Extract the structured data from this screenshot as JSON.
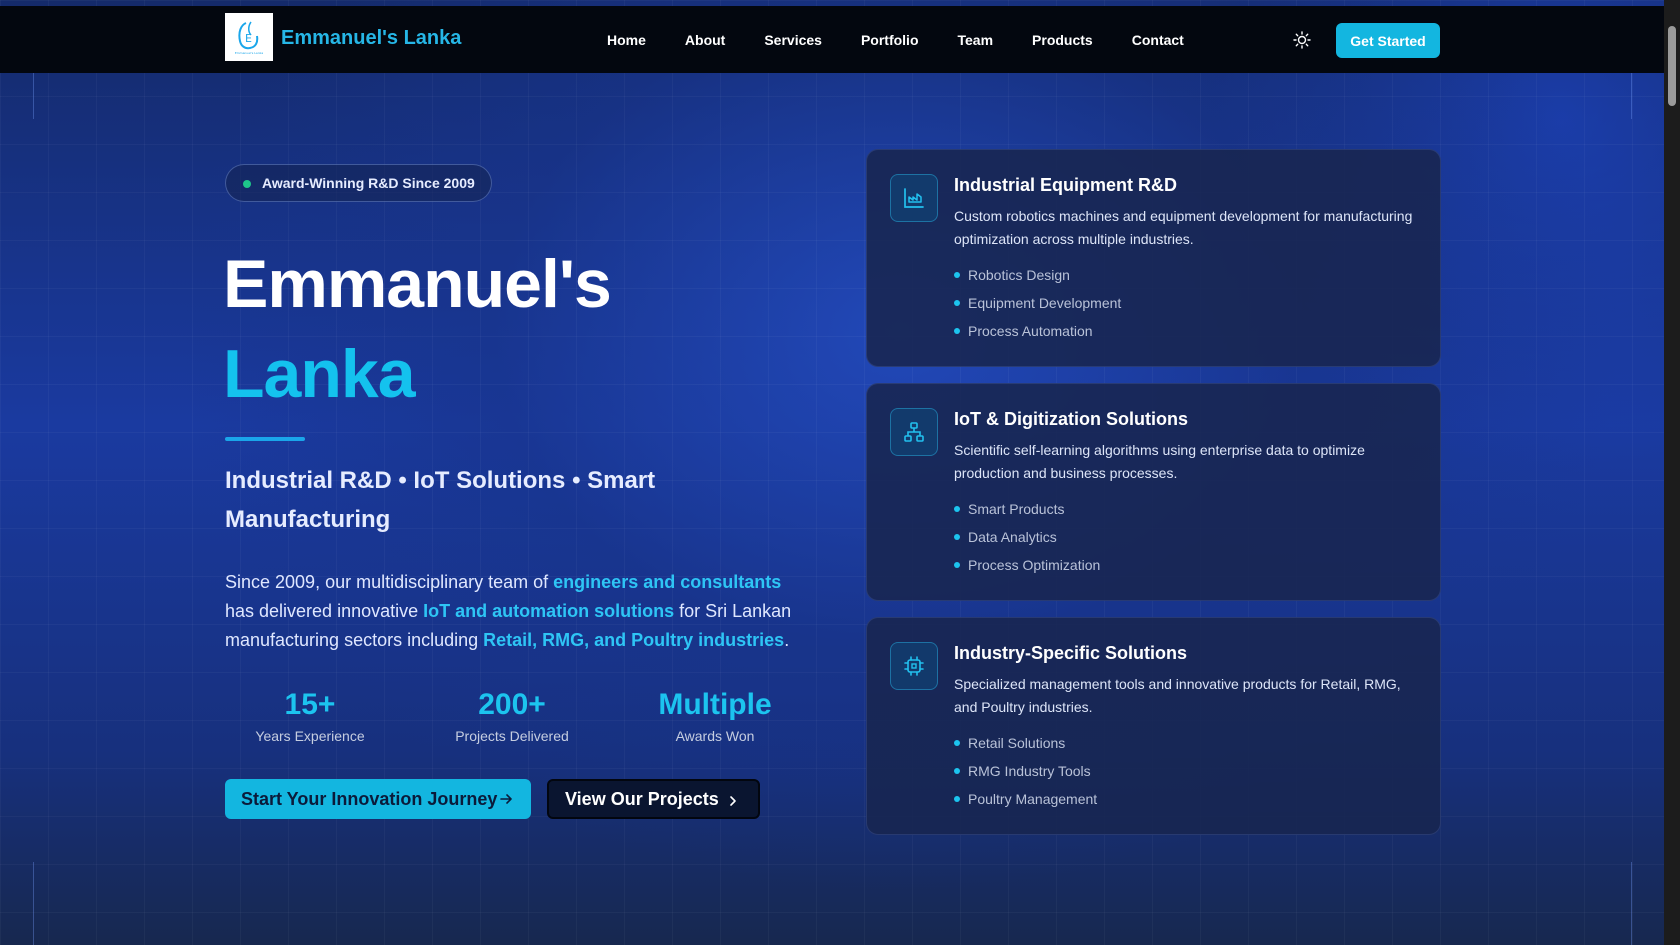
{
  "nav": {
    "brand": "Emmanuel's Lanka",
    "logo_caption": "Emmanuel's Lanka",
    "links": [
      "Home",
      "About",
      "Services",
      "Portfolio",
      "Team",
      "Products",
      "Contact"
    ],
    "cta": "Get Started"
  },
  "hero": {
    "badge": "Award-Winning R&D Since 2009",
    "title_line1": "Emmanuel's",
    "title_line2": "Lanka",
    "subtitle": "Industrial R&D • IoT Solutions • Smart Manufacturing",
    "desc_part1": "Since 2009, our multidisciplinary team of ",
    "desc_hl1": "engineers and consultants",
    "desc_part2": " has delivered innovative ",
    "desc_hl2": "IoT and automation solutions",
    "desc_part3": " for Sri Lankan manufacturing sectors including ",
    "desc_hl3": "Retail, RMG, and Poultry industries",
    "desc_part4": ".",
    "stats": [
      {
        "value": "15+",
        "label": "Years Experience"
      },
      {
        "value": "200+",
        "label": "Projects Delivered"
      },
      {
        "value": "Multiple",
        "label": "Awards Won"
      }
    ],
    "primary_button": "Start Your Innovation Journey",
    "secondary_button": "View Our Projects"
  },
  "cards": [
    {
      "icon": "factory-chart-icon",
      "title": "Industrial Equipment R&D",
      "desc": "Custom robotics machines and equipment development for manufacturing optimization across multiple industries.",
      "items": [
        "Robotics Design",
        "Equipment Development",
        "Process Automation"
      ]
    },
    {
      "icon": "network-icon",
      "title": "IoT & Digitization Solutions",
      "desc": "Scientific self-learning algorithms using enterprise data to optimize production and business processes.",
      "items": [
        "Smart Products",
        "Data Analytics",
        "Process Optimization"
      ]
    },
    {
      "icon": "cpu-chip-icon",
      "title": "Industry-Specific Solutions",
      "desc": "Specialized management tools and innovative products for Retail, RMG, and Poultry industries.",
      "items": [
        "Retail Solutions",
        "RMG Industry Tools",
        "Poultry Management"
      ]
    }
  ],
  "colors": {
    "accent": "#13b6e0",
    "brand": "#26b6e6",
    "navbar_bg": "#03070f",
    "bullet": "#1cc4ef"
  }
}
